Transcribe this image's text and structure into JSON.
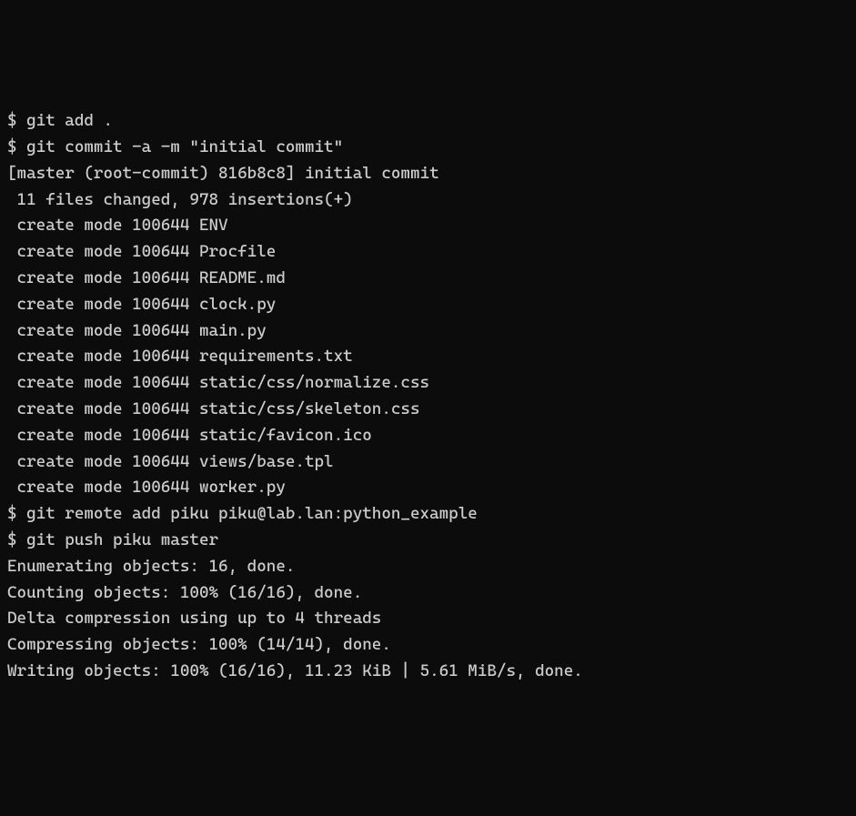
{
  "terminal": {
    "lines": [
      {
        "type": "prompt",
        "text": "$ git add ."
      },
      {
        "type": "prompt",
        "text": "$ git commit -a -m \"initial commit\""
      },
      {
        "type": "output",
        "text": "[master (root-commit) 816b8c8] initial commit"
      },
      {
        "type": "output",
        "text": " 11 files changed, 978 insertions(+)"
      },
      {
        "type": "output",
        "text": " create mode 100644 ENV"
      },
      {
        "type": "output",
        "text": " create mode 100644 Procfile"
      },
      {
        "type": "output",
        "text": " create mode 100644 README.md"
      },
      {
        "type": "output",
        "text": " create mode 100644 clock.py"
      },
      {
        "type": "output",
        "text": " create mode 100644 main.py"
      },
      {
        "type": "output",
        "text": " create mode 100644 requirements.txt"
      },
      {
        "type": "output",
        "text": " create mode 100644 static/css/normalize.css"
      },
      {
        "type": "output",
        "text": " create mode 100644 static/css/skeleton.css"
      },
      {
        "type": "output",
        "text": " create mode 100644 static/favicon.ico"
      },
      {
        "type": "output",
        "text": " create mode 100644 views/base.tpl"
      },
      {
        "type": "output",
        "text": " create mode 100644 worker.py"
      },
      {
        "type": "prompt",
        "text": "$ git remote add piku piku@lab.lan:python_example"
      },
      {
        "type": "prompt",
        "text": "$ git push piku master"
      },
      {
        "type": "output",
        "text": "Enumerating objects: 16, done."
      },
      {
        "type": "output",
        "text": "Counting objects: 100% (16/16), done."
      },
      {
        "type": "output",
        "text": "Delta compression using up to 4 threads"
      },
      {
        "type": "output",
        "text": "Compressing objects: 100% (14/14), done."
      },
      {
        "type": "output",
        "text": "Writing objects: 100% (16/16), 11.23 KiB | 5.61 MiB/s, done."
      }
    ]
  }
}
